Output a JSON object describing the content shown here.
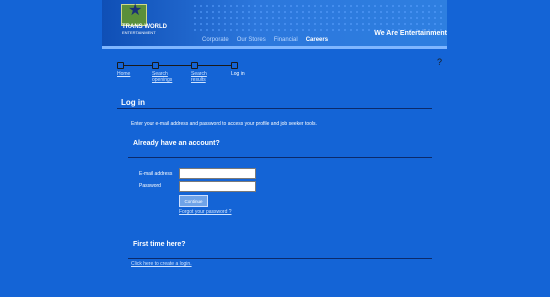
{
  "header": {
    "brand": "TRANS WORLD",
    "brand_sub": "ENTERTAINMENT",
    "tagline": "We Are Entertainment",
    "nav": [
      "Corporate",
      "Our Stores",
      "Financial",
      "Careers"
    ]
  },
  "page_number": "?",
  "steps": [
    {
      "label": "Home"
    },
    {
      "label": "Search openings"
    },
    {
      "label": "Search results"
    },
    {
      "label": "Log in"
    }
  ],
  "title": "Log in",
  "intro": "Enter your e-mail address and password to access your profile and job seeker tools.",
  "login": {
    "heading": "Already have an account?",
    "email_label": "E-mail address",
    "password_label": "Password",
    "continue_label": "Continue",
    "forgot_link": "Forgot your password ?"
  },
  "first_time": {
    "heading": "First time here?",
    "create_link": "Click here to create a login."
  }
}
